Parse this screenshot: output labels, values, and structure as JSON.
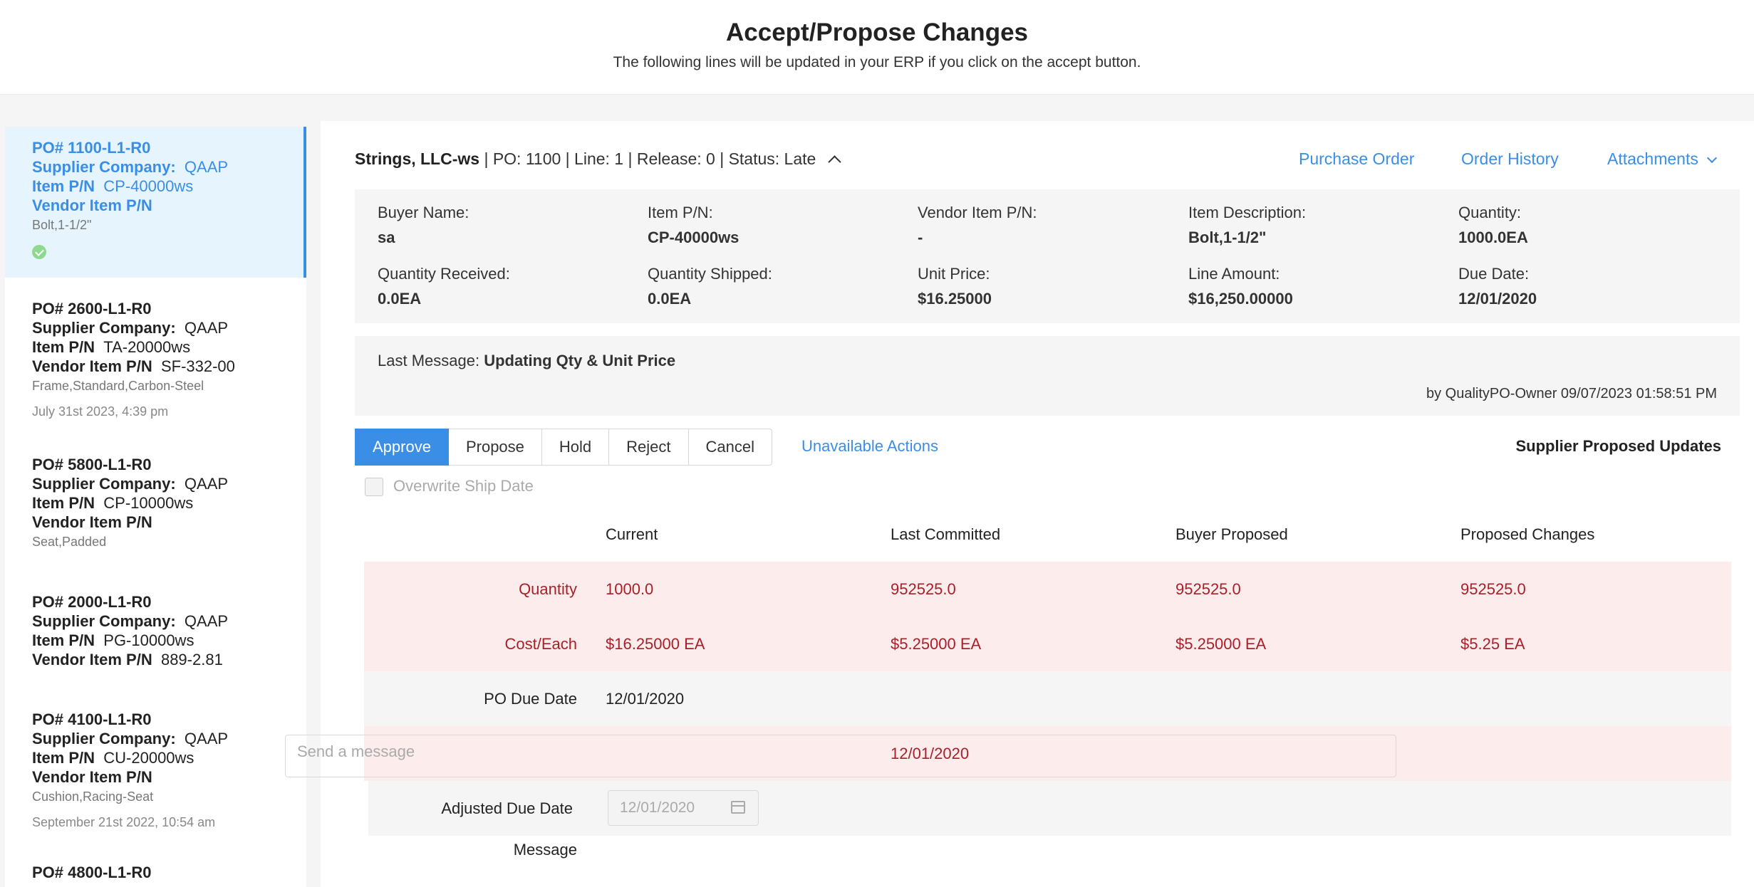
{
  "page": {
    "title": "Accept/Propose Changes",
    "subtitle": "The following lines will be updated in your ERP if you click on the accept button."
  },
  "sidebar": {
    "items": [
      {
        "po": "PO# 1100-L1-R0",
        "supplier_label": "Supplier Company:",
        "supplier": "QAAP",
        "item_label": "Item P/N",
        "item": "CP-40000ws",
        "vendor_label": "Vendor Item P/N",
        "vendor": "",
        "desc": "Bolt,1-1/2\"",
        "date": ""
      },
      {
        "po": "PO# 2600-L1-R0",
        "supplier_label": "Supplier Company:",
        "supplier": "QAAP",
        "item_label": "Item P/N",
        "item": "TA-20000ws",
        "vendor_label": "Vendor Item P/N",
        "vendor": "SF-332-00",
        "desc": "Frame,Standard,Carbon-Steel",
        "date": "July 31st 2023, 4:39 pm"
      },
      {
        "po": "PO# 5800-L1-R0",
        "supplier_label": "Supplier Company:",
        "supplier": "QAAP",
        "item_label": "Item P/N",
        "item": "CP-10000ws",
        "vendor_label": "Vendor Item P/N",
        "vendor": "",
        "desc": "Seat,Padded",
        "date": ""
      },
      {
        "po": "PO# 2000-L1-R0",
        "supplier_label": "Supplier Company:",
        "supplier": "QAAP",
        "item_label": "Item P/N",
        "item": "PG-10000ws",
        "vendor_label": "Vendor Item P/N",
        "vendor": "889-2.81",
        "desc": "",
        "date": ""
      },
      {
        "po": "PO# 4100-L1-R0",
        "supplier_label": "Supplier Company:",
        "supplier": "QAAP",
        "item_label": "Item P/N",
        "item": "CU-20000ws",
        "vendor_label": "Vendor Item P/N",
        "vendor": "",
        "desc": "Cushion,Racing-Seat",
        "date": "September 21st 2022, 10:54 am"
      },
      {
        "po": "PO# 4800-L1-R0"
      }
    ]
  },
  "header": {
    "company": "Strings, LLC-ws",
    "meta": " | PO: 1100 | Line: 1 | Release: 0 | Status: Late",
    "links": {
      "purchase_order": "Purchase Order",
      "order_history": "Order History",
      "attachments": "Attachments"
    }
  },
  "details": [
    {
      "label": "Buyer Name:",
      "value": "sa"
    },
    {
      "label": "Item P/N:",
      "value": "CP-40000ws"
    },
    {
      "label": "Vendor Item P/N:",
      "value": "-"
    },
    {
      "label": "Item Description:",
      "value": "Bolt,1-1/2\""
    },
    {
      "label": "Quantity:",
      "value": "1000.0EA"
    },
    {
      "label": "Quantity Received:",
      "value": "0.0EA"
    },
    {
      "label": "Quantity Shipped:",
      "value": "0.0EA"
    },
    {
      "label": "Unit Price:",
      "value": "$16.25000"
    },
    {
      "label": "Line Amount:",
      "value": "$16,250.00000"
    },
    {
      "label": "Due Date:",
      "value": "12/01/2020"
    }
  ],
  "last_message": {
    "label": "Last Message:",
    "text": "Updating Qty & Unit Price",
    "by": "by QualityPO-Owner 09/07/2023 01:58:51 PM"
  },
  "actions": {
    "approve": "Approve",
    "propose": "Propose",
    "hold": "Hold",
    "reject": "Reject",
    "cancel": "Cancel",
    "unavailable": "Unavailable Actions",
    "supplier_proposed": "Supplier Proposed Updates",
    "overwrite_ship_date": "Overwrite Ship Date"
  },
  "table": {
    "headers": [
      "Current",
      "Last Committed",
      "Buyer Proposed",
      "Proposed Changes"
    ],
    "rows": [
      {
        "label": "Quantity",
        "current": "1000.0",
        "last": "952525.0",
        "buyer": "952525.0",
        "proposed": "952525.0"
      },
      {
        "label": "Cost/Each",
        "current": "$16.25000 EA",
        "last": "$5.25000 EA",
        "buyer": "$5.25000 EA",
        "proposed": "$5.25 EA"
      },
      {
        "label": "PO Due Date",
        "current": "12/01/2020",
        "last": "",
        "buyer": "",
        "proposed": ""
      },
      {
        "label": "",
        "current": "",
        "last": "12/01/2020",
        "buyer": "",
        "proposed": ""
      }
    ],
    "adjusted_due_label": "Adjusted Due Date",
    "adjusted_due_value": "12/01/2020",
    "message_label": "Message",
    "message_placeholder": "Send a message"
  }
}
